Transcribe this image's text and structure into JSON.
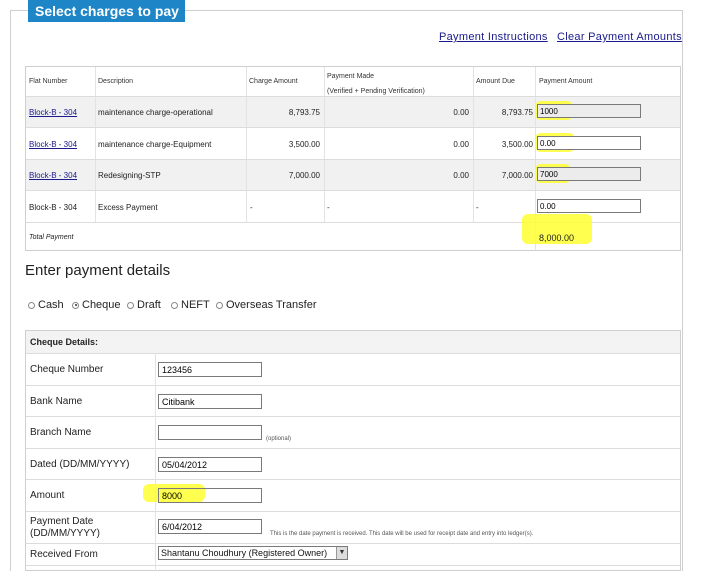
{
  "header": {
    "title": "Select charges to pay"
  },
  "links": {
    "payment_instructions": "Payment Instructions",
    "clear_payment_amounts": "Clear Payment Amounts"
  },
  "charges_table": {
    "headers": {
      "flat_number": "Flat Number",
      "description": "Description",
      "charge_amount": "Charge Amount",
      "payment_made": "Payment Made",
      "payment_made_sub": "(Verified + Pending Verification)",
      "amount_due": "Amount Due",
      "payment_amount": "Payment Amount"
    },
    "rows": [
      {
        "flat": "Block-B - 304",
        "description": "maintenance charge-operational",
        "charge": "8,793.75",
        "paid": "0.00",
        "due": "8,793.75",
        "payment": "1000"
      },
      {
        "flat": "Block-B - 304",
        "description": "maintenance charge-Equipment",
        "charge": "3,500.00",
        "paid": "0.00",
        "due": "3,500.00",
        "payment": "0.00"
      },
      {
        "flat": "Block-B - 304",
        "description": "Redesigning-STP",
        "charge": "7,000.00",
        "paid": "0.00",
        "due": "7,000.00",
        "payment": "7000"
      },
      {
        "flat": "Block-B - 304",
        "description": "Excess Payment",
        "charge": "-",
        "paid": "-",
        "due": "-",
        "payment": "0.00"
      }
    ],
    "total_label": "Total Payment",
    "total_value": "8,000.00"
  },
  "payment_details": {
    "title": "Enter payment details",
    "methods": [
      "Cash",
      "Cheque",
      "Draft",
      "NEFT",
      "Overseas Transfer"
    ],
    "selected_method": "Cheque"
  },
  "cheque": {
    "section_title": "Cheque Details:",
    "cheque_number_label": "Cheque Number",
    "cheque_number": "123456",
    "bank_name_label": "Bank Name",
    "bank_name": "Citibank",
    "branch_name_label": "Branch Name",
    "branch_name": "",
    "branch_optional": "(optional)",
    "dated_label": "Dated (DD/MM/YYYY)",
    "dated": "05/04/2012",
    "amount_label": "Amount",
    "amount": "8000",
    "payment_date_label_1": "Payment Date",
    "payment_date_label_2": "(DD/MM/YYYY)",
    "payment_date": "6/04/2012",
    "payment_date_note": "This is the date payment is received. This date will be used for receipt date and entry into ledger(s).",
    "received_from_label": "Received From",
    "received_from": "Shantanu Choudhury (Registered Owner)"
  },
  "colors": {
    "tab_blue": "#1e86c7",
    "link_blue": "#1a1a8c",
    "highlight_yellow": "#ffff30"
  }
}
